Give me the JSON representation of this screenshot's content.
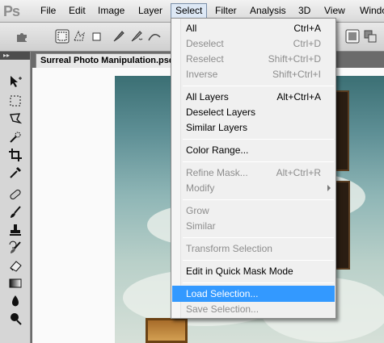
{
  "app": {
    "logo": "Ps"
  },
  "menubar": {
    "items": [
      "File",
      "Edit",
      "Image",
      "Layer",
      "Select",
      "Filter",
      "Analysis",
      "3D",
      "View",
      "Windo"
    ],
    "active": "Select"
  },
  "document": {
    "tab_title": "Surreal Photo Manipulation.psd"
  },
  "select_menu": {
    "items": [
      {
        "label": "All",
        "shortcut": "Ctrl+A",
        "enabled": true
      },
      {
        "label": "Deselect",
        "shortcut": "Ctrl+D",
        "enabled": false
      },
      {
        "label": "Reselect",
        "shortcut": "Shift+Ctrl+D",
        "enabled": false
      },
      {
        "label": "Inverse",
        "shortcut": "Shift+Ctrl+I",
        "enabled": false
      },
      {
        "label": "All Layers",
        "shortcut": "Alt+Ctrl+A",
        "enabled": true
      },
      {
        "label": "Deselect Layers",
        "shortcut": "",
        "enabled": true
      },
      {
        "label": "Similar Layers",
        "shortcut": "",
        "enabled": true
      },
      {
        "label": "Color Range...",
        "shortcut": "",
        "enabled": true
      },
      {
        "label": "Refine Mask...",
        "shortcut": "Alt+Ctrl+R",
        "enabled": false
      },
      {
        "label": "Modify",
        "shortcut": "",
        "enabled": false,
        "submenu": true
      },
      {
        "label": "Grow",
        "shortcut": "",
        "enabled": false
      },
      {
        "label": "Similar",
        "shortcut": "",
        "enabled": false
      },
      {
        "label": "Transform Selection",
        "shortcut": "",
        "enabled": false
      },
      {
        "label": "Edit in Quick Mask Mode",
        "shortcut": "",
        "enabled": true
      },
      {
        "label": "Load Selection...",
        "shortcut": "",
        "enabled": true,
        "highlighted": true
      },
      {
        "label": "Save Selection...",
        "shortcut": "",
        "enabled": false
      }
    ]
  },
  "colors": {
    "highlight": "#3399ff",
    "disabled_text": "#8d8d8d"
  }
}
